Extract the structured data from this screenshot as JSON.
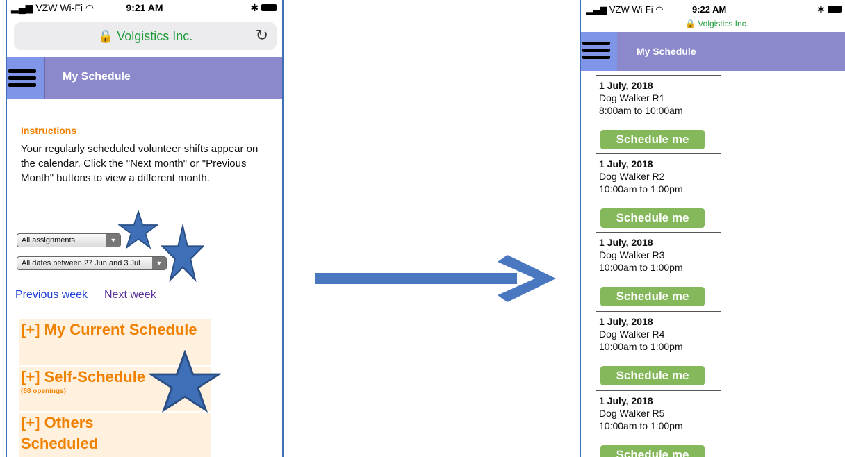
{
  "left": {
    "status": {
      "carrier": "VZW Wi-Fi",
      "time": "9:21 AM"
    },
    "url": "Volgistics Inc.",
    "header_title": "My Schedule",
    "instructions_heading": "Instructions",
    "instructions_text": "Your regularly scheduled volunteer shifts appear on the calendar. Click the \"Next month\" or \"Previous Month\" buttons to view a different month.",
    "filter_assignments": "All assignments",
    "filter_dates": "All dates between 27 Jun and 3 Jul",
    "prev_week": "Previous week",
    "next_week": "Next week",
    "sections": [
      {
        "label": "[+] My Current Schedule",
        "sub": ""
      },
      {
        "label": "[+] Self-Schedule",
        "sub": "(68 openings)"
      },
      {
        "label": "[+] Others Scheduled",
        "sub": ""
      }
    ]
  },
  "right": {
    "status": {
      "carrier": "VZW Wi-Fi",
      "time": "9:22 AM"
    },
    "url": "Volgistics Inc.",
    "header_title": "My Schedule",
    "entries": [
      {
        "date": "1 July, 2018",
        "role": "Dog Walker R1",
        "time": "8:00am to 10:00am",
        "button": "Schedule me"
      },
      {
        "date": "1 July, 2018",
        "role": "Dog Walker R2",
        "time": "10:00am to 1:00pm",
        "button": "Schedule me"
      },
      {
        "date": "1 July, 2018",
        "role": "Dog Walker R3",
        "time": "10:00am to 1:00pm",
        "button": "Schedule me"
      },
      {
        "date": "1 July, 2018",
        "role": "Dog Walker R4",
        "time": "10:00am to 1:00pm",
        "button": "Schedule me"
      },
      {
        "date": "1 July, 2018",
        "role": "Dog Walker R5",
        "time": "10:00am to 1:00pm",
        "button": "Schedule me"
      },
      {
        "date": "",
        "role": "",
        "time": "",
        "button": "Schedule me"
      }
    ]
  },
  "colors": {
    "header_bar": "#8c88cc",
    "menu_button": "#7e95e8",
    "accent_orange": "#f08000",
    "button_green": "#84b85a",
    "annotation_blue": "#3f6fb6"
  },
  "icons": [
    "hamburger-menu-icon",
    "lock-icon",
    "reload-icon",
    "wifi-icon",
    "bluetooth-icon",
    "battery-icon",
    "star-annotation-icon",
    "right-arrow-icon"
  ]
}
